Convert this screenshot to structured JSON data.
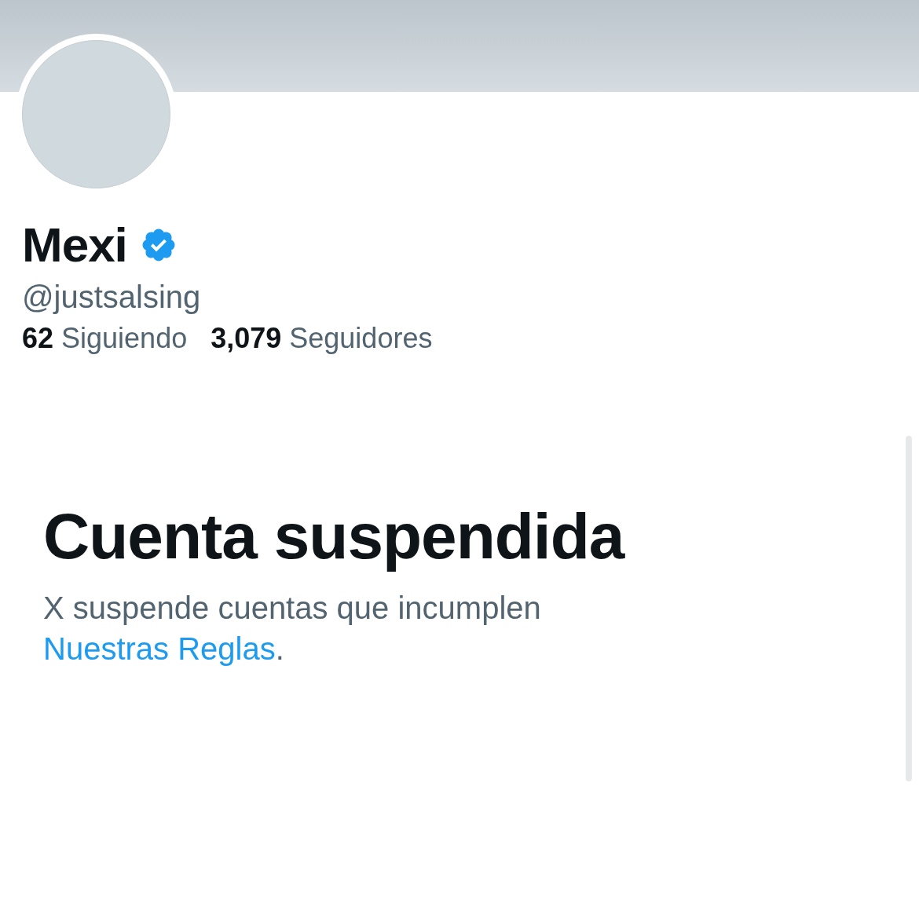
{
  "profile": {
    "name": "Mexi",
    "verified": true,
    "handle": "@justsalsing",
    "stats": [
      "**62** Siguiendo",
      "**3,079** Seguidores"
    ]
  },
  "notice": {
    "title": "Cuenta suspendida",
    "text": "X suspende cuentas que incumplen",
    "link": "Nuestras Reglas",
    "after": "."
  }
}
